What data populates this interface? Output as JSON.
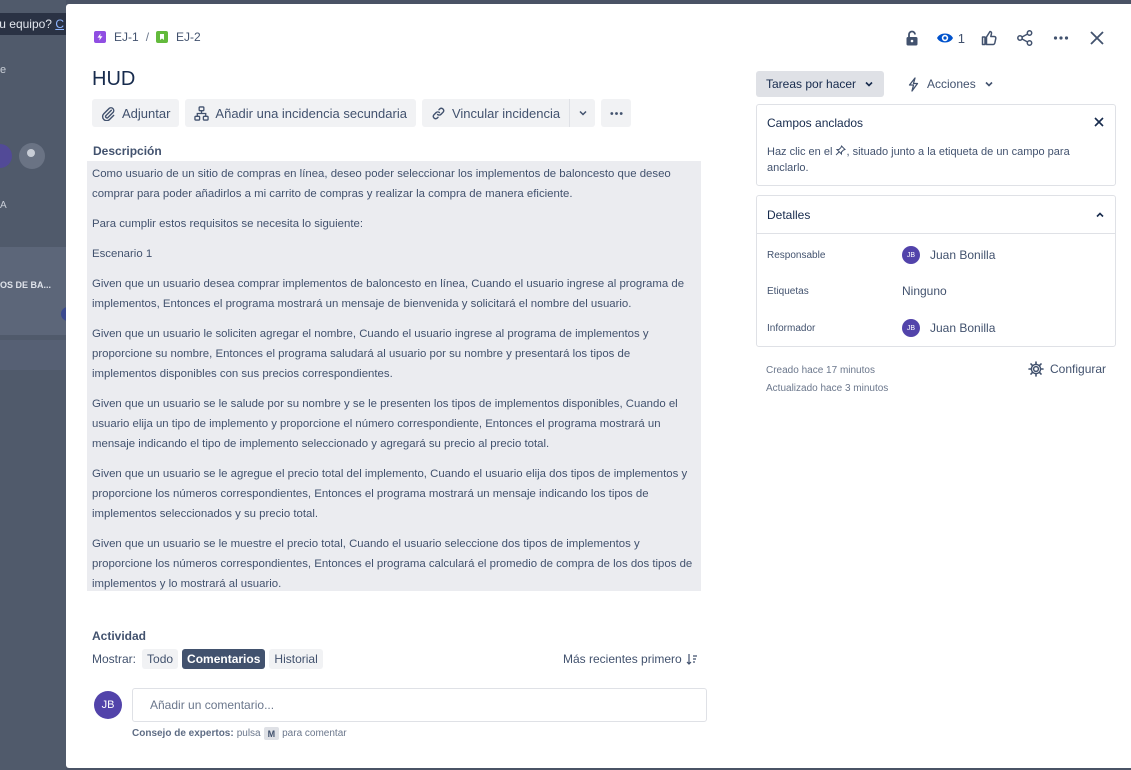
{
  "background": {
    "team_prompt": "tu equipo?",
    "team_link": "C",
    "side_letter": "e",
    "avatar_initial": "B",
    "column_letter": "A",
    "card_text": "OS DE BA..."
  },
  "breadcrumb": {
    "parent_key": "EJ-1",
    "separator": "/",
    "issue_key": "EJ-2"
  },
  "top_actions": {
    "watch_count": "1"
  },
  "issue": {
    "title": "HUD"
  },
  "toolbar": {
    "attach": "Adjuntar",
    "add_child": "Añadir una incidencia secundaria",
    "link_issue": "Vincular incidencia"
  },
  "description": {
    "label": "Descripción",
    "paragraphs": [
      "Como usuario de un sitio de compras en línea, deseo poder seleccionar los implementos de baloncesto que deseo comprar para poder añadirlos a mi carrito de compras y realizar la compra de manera eficiente.",
      "Para cumplir estos requisitos se necesita lo siguiente:",
      "Escenario 1",
      "Given que un usuario desea comprar implementos de baloncesto en línea, Cuando el usuario ingrese al programa de implementos, Entonces el programa mostrará un mensaje de bienvenida y solicitará el nombre del usuario.",
      "Given que un usuario le soliciten agregar el nombre, Cuando el usuario ingrese al programa de implementos y proporcione su nombre, Entonces el programa saludará al usuario por su nombre y presentará los tipos de implementos disponibles con sus precios correspondientes.",
      "Given que un usuario se le salude por su nombre y se le presenten los tipos de implementos disponibles, Cuando el usuario elija un tipo de implemento y proporcione el número correspondiente, Entonces el programa mostrará un mensaje indicando el tipo de implemento seleccionado y agregará su precio al precio total.",
      "Given que un usuario se le agregue el precio total del implemento, Cuando el usuario elija dos tipos de implementos y proporcione los números correspondientes, Entonces el programa mostrará un mensaje indicando los tipos de implementos seleccionados y su precio total.",
      "Given que un usuario se le muestre el precio total, Cuando el usuario seleccione dos tipos de implementos y proporcione los números correspondientes, Entonces el programa calculará el promedio de compra de los dos tipos de implementos y lo mostrará al usuario."
    ]
  },
  "activity": {
    "label": "Actividad",
    "show_label": "Mostrar:",
    "filters": [
      "Todo",
      "Comentarios",
      "Historial"
    ],
    "active_filter": "Comentarios",
    "sort_label": "Más recientes primero",
    "user_initials": "JB",
    "comment_placeholder": "Añadir un comentario...",
    "tip_bold": "Consejo de expertos:",
    "tip_pre": "pulsa",
    "tip_key": "M",
    "tip_post": "para comentar"
  },
  "sidebar": {
    "status": "Tareas por hacer",
    "actions": "Acciones",
    "pinned": {
      "title": "Campos anclados",
      "text_before": "Haz clic en el",
      "text_after": ", situado junto a la etiqueta de un campo para anclarlo."
    },
    "details": {
      "title": "Detalles",
      "fields": [
        {
          "label": "Responsable",
          "value": "Juan Bonilla",
          "initials": "JB"
        },
        {
          "label": "Etiquetas",
          "value": "Ninguno"
        },
        {
          "label": "Informador",
          "value": "Juan Bonilla",
          "initials": "JB"
        }
      ]
    },
    "created": "Creado hace 17 minutos",
    "updated": "Actualizado hace 3 minutos",
    "configure": "Configurar"
  },
  "colors": {
    "avatar": "#5243aa",
    "epic": "#904ee2",
    "story": "#63ba3c",
    "active_chip": "#42526e",
    "description_bg": "#ebecf0"
  }
}
